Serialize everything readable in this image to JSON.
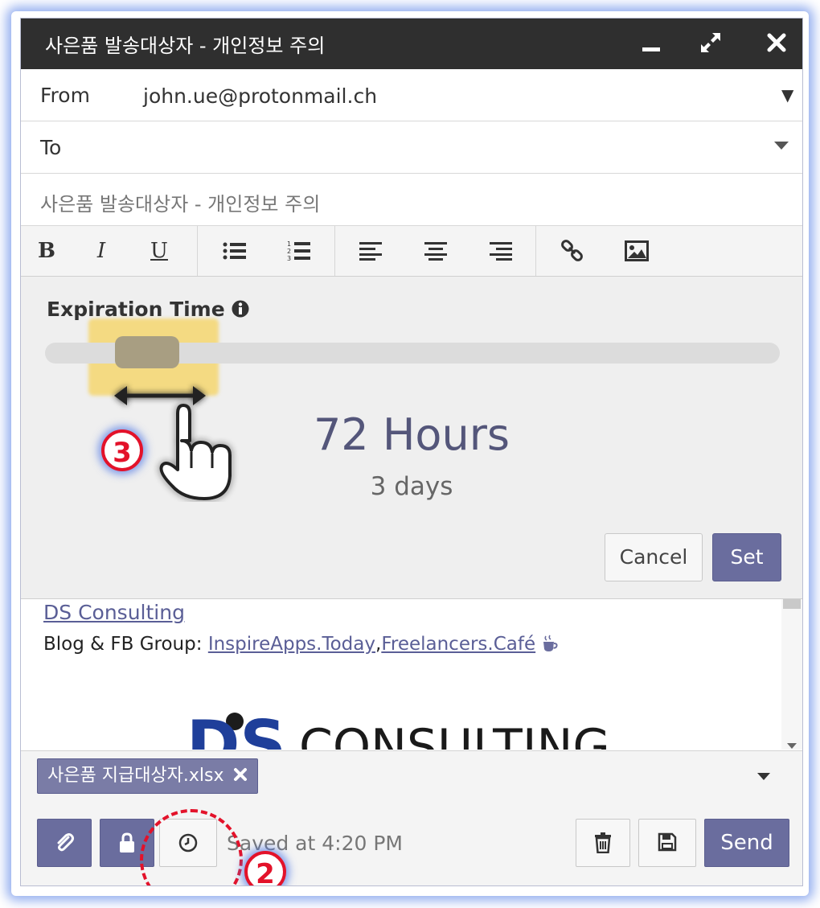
{
  "window": {
    "title": "사은품 발송대상자 - 개인정보 주의",
    "minimize_icon": "minimize-icon",
    "maximize_icon": "expand-icon",
    "close_icon": "close-icon"
  },
  "from": {
    "label": "From",
    "value": "john.ue@protonmail.ch"
  },
  "to": {
    "label": "To",
    "value": ""
  },
  "subject": {
    "value": "사은품 발송대상자 - 개인정보 주의"
  },
  "toolbar": {
    "bold": "B",
    "italic": "I",
    "underline": "U",
    "icons": [
      "bulleted-list-icon",
      "numbered-list-icon",
      "align-left-icon",
      "align-center-icon",
      "align-right-icon",
      "link-icon",
      "image-icon"
    ]
  },
  "expiration": {
    "title": "Expiration Time",
    "info_icon": "info-icon",
    "slider_level": 0.07,
    "hours_text": "72 Hours",
    "days_text": "3 days",
    "cancel_label": "Cancel",
    "set_label": "Set"
  },
  "body": {
    "company_link": "DS Consulting",
    "blog_prefix": "Blog & FB Group:",
    "blog_link_1": "InspireApps.Today",
    "comma": ",",
    "blog_link_2": "Freelancers.Café",
    "logo_text": "CONSULTING",
    "logo_letters": "DS"
  },
  "attachments": [
    {
      "name": "사은품 지급대상자.xlsx"
    }
  ],
  "footer": {
    "saved_text": "Saved at 4:20 PM",
    "send_label": "Send"
  },
  "annotations": {
    "step2": "2",
    "step3": "3"
  },
  "colors": {
    "primary": "#6a6d9e",
    "titlebar": "#2f2f2f",
    "annotation": "#e3122a"
  }
}
